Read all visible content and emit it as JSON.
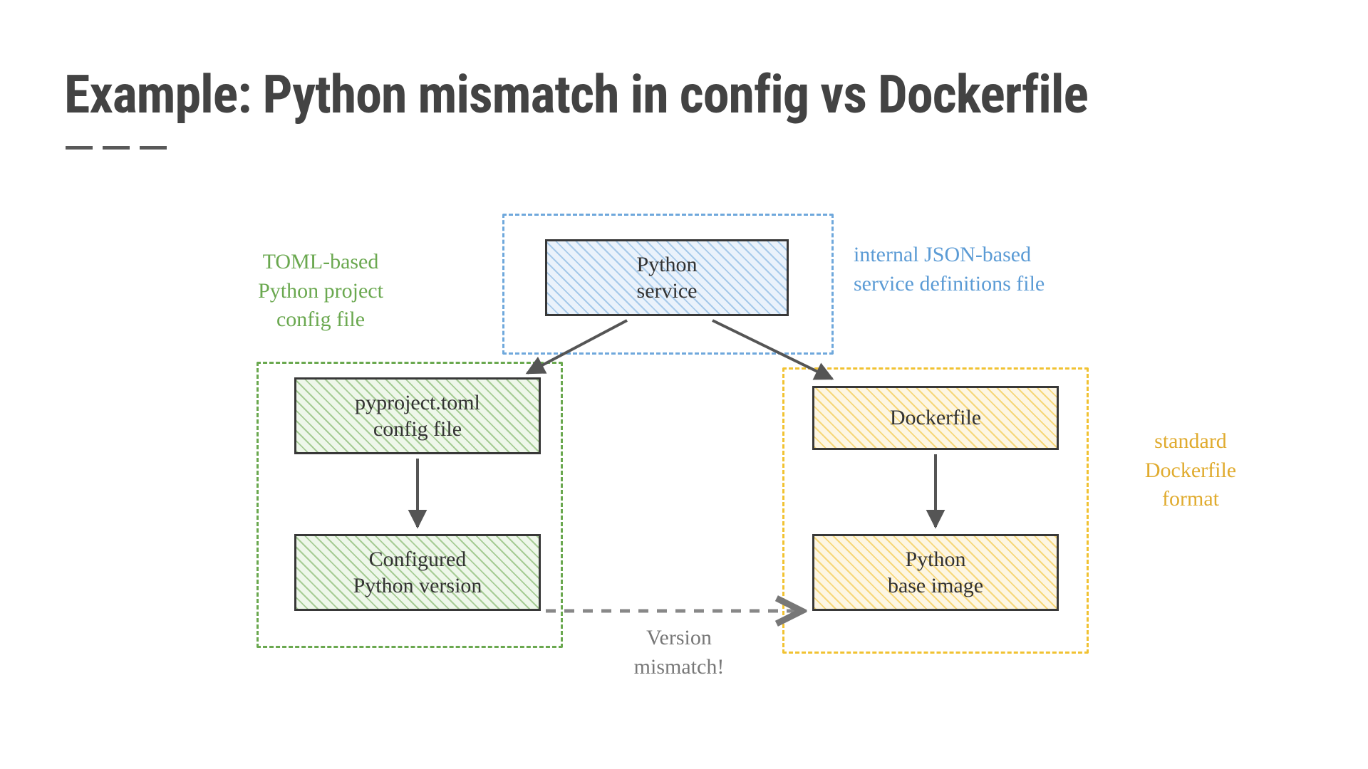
{
  "title": "Example: Python mismatch in config vs Dockerfile",
  "captions": {
    "toml": "TOML-based\nPython project\nconfig file",
    "json": "internal JSON-based\nservice definitions file",
    "docker": "standard\nDockerfile\nformat",
    "mismatch": "Version\nmismatch!"
  },
  "boxes": {
    "service": "Python\nservice",
    "pyproject": "pyproject.toml\nconfig file",
    "configured": "Configured\nPython version",
    "dockerfile": "Dockerfile",
    "baseimage": "Python\nbase image"
  }
}
